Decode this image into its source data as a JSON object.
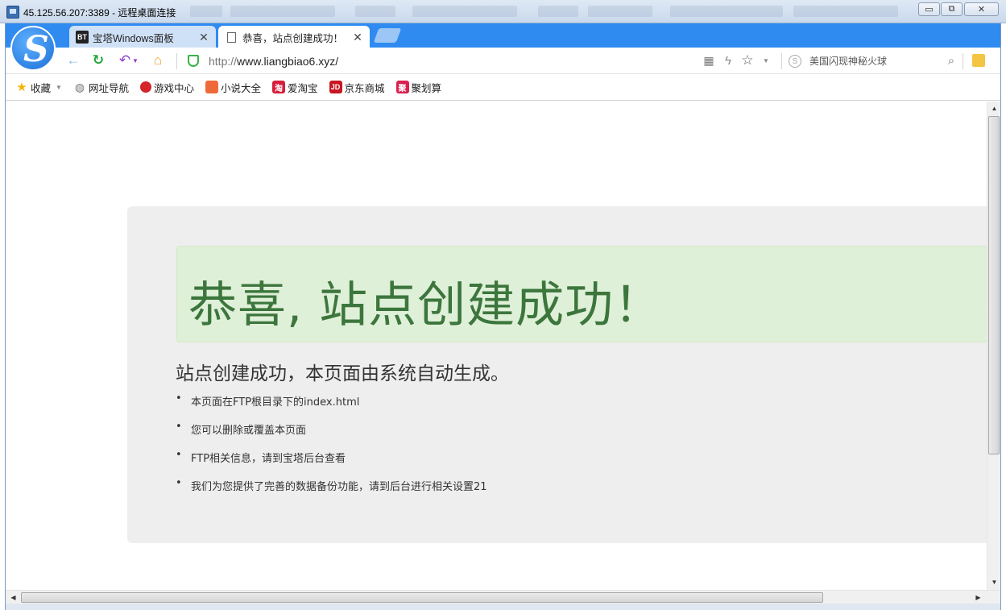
{
  "rdp": {
    "title": "45.125.56.207:3389 - 远程桌面连接"
  },
  "browser": {
    "tabs": [
      {
        "favicon": "BT",
        "label": "宝塔Windows面板",
        "close": "✕"
      },
      {
        "favicon": "",
        "label": "恭喜，站点创建成功！",
        "close": "✕"
      }
    ],
    "url_scheme": "http://",
    "url_host": "www.liangbiao6.xyz/",
    "search_engine_glyph": "S",
    "search_placeholder": "美国闪现神秘火球",
    "bookmarks": [
      {
        "label": "收藏",
        "icon": "star-icon",
        "color": "#f5b400"
      },
      {
        "label": "网址导航",
        "icon": "globe-icon",
        "color": "#777777"
      },
      {
        "label": "游戏中心",
        "icon": "game-icon",
        "color": "#d4252a"
      },
      {
        "label": "小说大全",
        "icon": "book-icon",
        "color": "#ef6a3a"
      },
      {
        "label": "爱淘宝",
        "icon": "taobao-icon",
        "glyph": "淘",
        "color": "#d81e3b"
      },
      {
        "label": "京东商城",
        "icon": "jd-icon",
        "glyph": "JD",
        "color": "#c81623"
      },
      {
        "label": "聚划算",
        "icon": "juhuasuan-icon",
        "glyph": "聚",
        "color": "#d8204f"
      }
    ]
  },
  "page": {
    "headline": "恭喜, 站点创建成功！",
    "subtitle": "站点创建成功，本页面由系统自动生成。",
    "items": [
      "本页面在FTP根目录下的index.html",
      "您可以删除或覆盖本页面",
      "FTP相关信息，请到宝塔后台查看",
      "我们为您提供了完善的数据备份功能，请到后台进行相关设置21"
    ]
  },
  "colors": {
    "tabstrip": "#2f8bf0",
    "success_bg": "#dff0d8",
    "success_text": "#3c763d",
    "jumbotron_bg": "#eeeeee"
  }
}
